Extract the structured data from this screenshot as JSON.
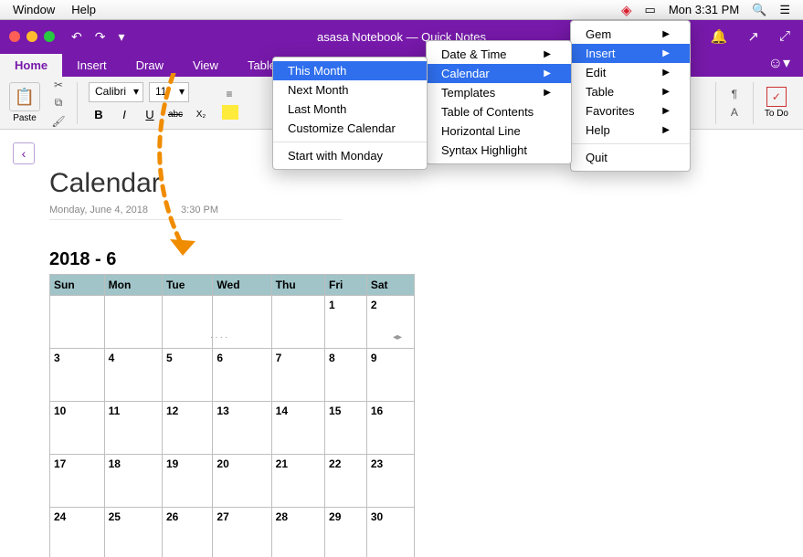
{
  "mac_menu": {
    "window": "Window",
    "help": "Help",
    "clock": "Mon 3:31 PM"
  },
  "app": {
    "title": "asasa Notebook — Quick Notes",
    "tabs": {
      "home": "Home",
      "insert": "Insert",
      "draw": "Draw",
      "view": "View",
      "table": "Table"
    }
  },
  "ribbon": {
    "paste": "Paste",
    "font": "Calibri",
    "size": "11",
    "bold": "B",
    "italic": "I",
    "underline": "U",
    "strike": "abc",
    "subscript": "X₂",
    "todo": "To Do",
    "check": "✓"
  },
  "page": {
    "title": "Calendar",
    "date": "Monday, June 4, 2018",
    "time": "3:30 PM",
    "cal_title": "2018 - 6",
    "days": [
      "Sun",
      "Mon",
      "Tue",
      "Wed",
      "Thu",
      "Fri",
      "Sat"
    ],
    "rows": [
      [
        "",
        "",
        "",
        "",
        "",
        "1",
        "2"
      ],
      [
        "3",
        "4",
        "5",
        "6",
        "7",
        "8",
        "9"
      ],
      [
        "10",
        "11",
        "12",
        "13",
        "14",
        "15",
        "16"
      ],
      [
        "17",
        "18",
        "19",
        "20",
        "21",
        "22",
        "23"
      ],
      [
        "24",
        "25",
        "26",
        "27",
        "28",
        "29",
        "30"
      ]
    ]
  },
  "gem_menu": {
    "gem": "Gem",
    "insert": "Insert",
    "edit": "Edit",
    "table": "Table",
    "favorites": "Favorites",
    "help": "Help",
    "quit": "Quit"
  },
  "insert_menu": {
    "datetime": "Date & Time",
    "calendar": "Calendar",
    "templates": "Templates",
    "toc": "Table of Contents",
    "hline": "Horizontal Line",
    "syntax": "Syntax Highlight"
  },
  "calendar_menu": {
    "this": "This Month",
    "next": "Next Month",
    "last": "Last Month",
    "customize": "Customize Calendar",
    "start": "Start with Monday"
  }
}
